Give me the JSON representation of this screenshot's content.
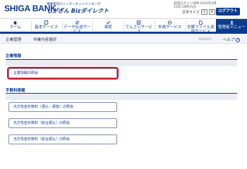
{
  "header": {
    "brand": "SHIGA BANK",
    "tagline": "事業者向けインターネットバンキング",
    "service": "しがぎん Bizダイレクト",
    "user_info": "前回ログイン日時 2024年4月15日 10時15分",
    "font_size_label": "文字サイズ",
    "font_small": "小",
    "font_large": "大",
    "logout": "ログアウト"
  },
  "nav": [
    {
      "label": "ホーム",
      "icon": "home-icon"
    },
    {
      "label": "基本サービス",
      "icon": "basic-service-icon"
    },
    {
      "label": "データ伝送サービス",
      "icon": "data-transfer-icon"
    },
    {
      "label": "承認",
      "icon": "approval-icon"
    },
    {
      "label": "でんさいサービス",
      "icon": "densai-icon"
    },
    {
      "label": "外為サービス",
      "icon": "forex-icon"
    },
    {
      "label": "全銀ファイル送信サービス",
      "icon": "file-send-icon"
    },
    {
      "label": "管理者メニュー",
      "icon": "admin-menu-icon",
      "active": true
    }
  ],
  "breadcrumb": {
    "item1": "企業管理",
    "item2": "作業内容選択",
    "screen_id": "BKSK001",
    "help": "ヘルプ",
    "help_glyph": "?"
  },
  "sections": {
    "company": {
      "title": "企業情報",
      "buttons": [
        "企業情報の照会"
      ]
    },
    "fees": {
      "title": "手数料情報",
      "buttons": [
        "先方負担手数料（振込・振替）の照会",
        "先方負担手数料（総合振込）の照会",
        "当方負担手数料（総合振込）の照会"
      ]
    }
  },
  "colors": {
    "primary": "#0d3c8f",
    "highlight": "#e0101b"
  }
}
